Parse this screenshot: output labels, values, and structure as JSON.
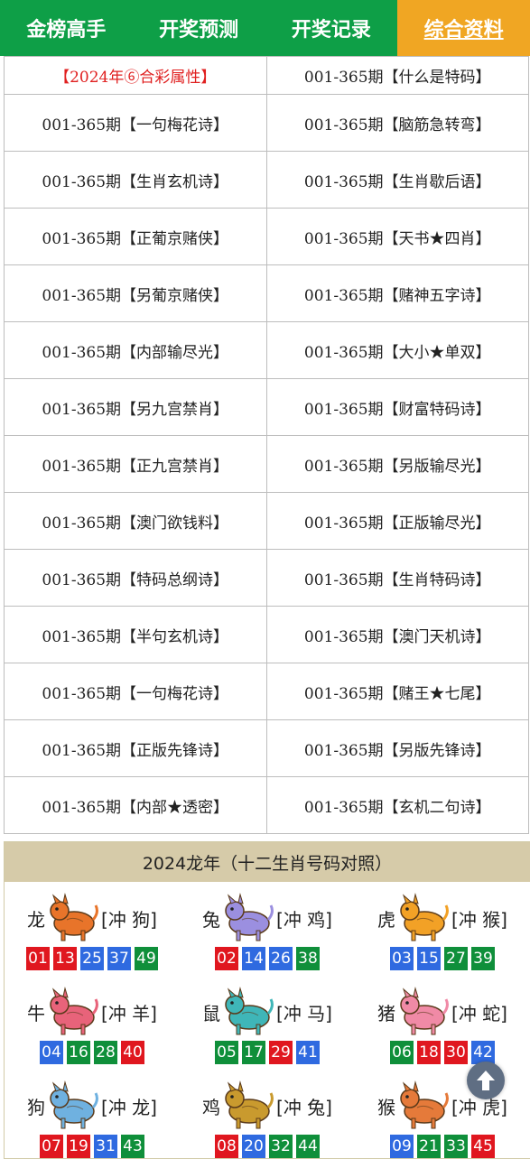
{
  "nav": {
    "tabs": [
      "金榜高手",
      "开奖预测",
      "开奖记录",
      "综合资料"
    ]
  },
  "grid": {
    "rows": [
      [
        "【2024年⑥合彩属性】",
        "001-365期【什么是特码】"
      ],
      [
        "001-365期【一句梅花诗】",
        "001-365期【脑筋急转弯】"
      ],
      [
        "001-365期【生肖玄机诗】",
        "001-365期【生肖歇后语】"
      ],
      [
        "001-365期【正葡京赌侠】",
        "001-365期【天书★四肖】"
      ],
      [
        "001-365期【另葡京赌侠】",
        "001-365期【赌神五字诗】"
      ],
      [
        "001-365期【内部输尽光】",
        "001-365期【大小★单双】"
      ],
      [
        "001-365期【另九宫禁肖】",
        "001-365期【财富特码诗】"
      ],
      [
        "001-365期【正九宫禁肖】",
        "001-365期【另版输尽光】"
      ],
      [
        "001-365期【澳门欲钱料】",
        "001-365期【正版输尽光】"
      ],
      [
        "001-365期【特码总纲诗】",
        "001-365期【生肖特码诗】"
      ],
      [
        "001-365期【半句玄机诗】",
        "001-365期【澳门天机诗】"
      ],
      [
        "001-365期【一句梅花诗】",
        "001-365期【赌王★七尾】"
      ],
      [
        "001-365期【正版先锋诗】",
        "001-365期【另版先锋诗】"
      ],
      [
        "001-365期【内部★透密】",
        "001-365期【玄机二句诗】"
      ]
    ]
  },
  "zodiac": {
    "title": "2024龙年（十二生肖号码对照）",
    "animals": [
      {
        "name": "龙",
        "chong": "[冲 狗]",
        "icon": "dragon-icon",
        "color": "#e8742a",
        "balls": [
          [
            "01",
            "red"
          ],
          [
            "13",
            "red"
          ],
          [
            "25",
            "blue"
          ],
          [
            "37",
            "blue"
          ],
          [
            "49",
            "green"
          ]
        ]
      },
      {
        "name": "兔",
        "chong": "[冲 鸡]",
        "icon": "rabbit-icon",
        "color": "#9b8fe0",
        "balls": [
          [
            "02",
            "red"
          ],
          [
            "14",
            "blue"
          ],
          [
            "26",
            "blue"
          ],
          [
            "38",
            "green"
          ]
        ]
      },
      {
        "name": "虎",
        "chong": "[冲 猴]",
        "icon": "tiger-icon",
        "color": "#f2a126",
        "balls": [
          [
            "03",
            "blue"
          ],
          [
            "15",
            "blue"
          ],
          [
            "27",
            "green"
          ],
          [
            "39",
            "green"
          ]
        ]
      },
      {
        "name": "牛",
        "chong": "[冲 羊]",
        "icon": "ox-icon",
        "color": "#e8637a",
        "balls": [
          [
            "04",
            "blue"
          ],
          [
            "16",
            "green"
          ],
          [
            "28",
            "green"
          ],
          [
            "40",
            "red"
          ]
        ]
      },
      {
        "name": "鼠",
        "chong": "[冲 马]",
        "icon": "rat-icon",
        "color": "#3fb6b8",
        "balls": [
          [
            "05",
            "green"
          ],
          [
            "17",
            "green"
          ],
          [
            "29",
            "red"
          ],
          [
            "41",
            "blue"
          ]
        ]
      },
      {
        "name": "猪",
        "chong": "[冲 蛇]",
        "icon": "pig-icon",
        "color": "#f08aa6",
        "balls": [
          [
            "06",
            "green"
          ],
          [
            "18",
            "red"
          ],
          [
            "30",
            "red"
          ],
          [
            "42",
            "blue"
          ]
        ]
      },
      {
        "name": "狗",
        "chong": "[冲 龙]",
        "icon": "dog-icon",
        "color": "#6fb1e0",
        "balls": [
          [
            "07",
            "red"
          ],
          [
            "19",
            "red"
          ],
          [
            "31",
            "blue"
          ],
          [
            "43",
            "green"
          ]
        ]
      },
      {
        "name": "鸡",
        "chong": "[冲 兔]",
        "icon": "rooster-icon",
        "color": "#c99a2e",
        "balls": [
          [
            "08",
            "red"
          ],
          [
            "20",
            "blue"
          ],
          [
            "32",
            "green"
          ],
          [
            "44",
            "green"
          ]
        ]
      },
      {
        "name": "猴",
        "chong": "[冲 虎]",
        "icon": "monkey-icon",
        "color": "#e57a3a",
        "balls": [
          [
            "09",
            "blue"
          ],
          [
            "21",
            "green"
          ],
          [
            "33",
            "green"
          ],
          [
            "45",
            "red"
          ]
        ]
      }
    ]
  },
  "scroll_top": {
    "icon": "arrow-up-icon"
  }
}
